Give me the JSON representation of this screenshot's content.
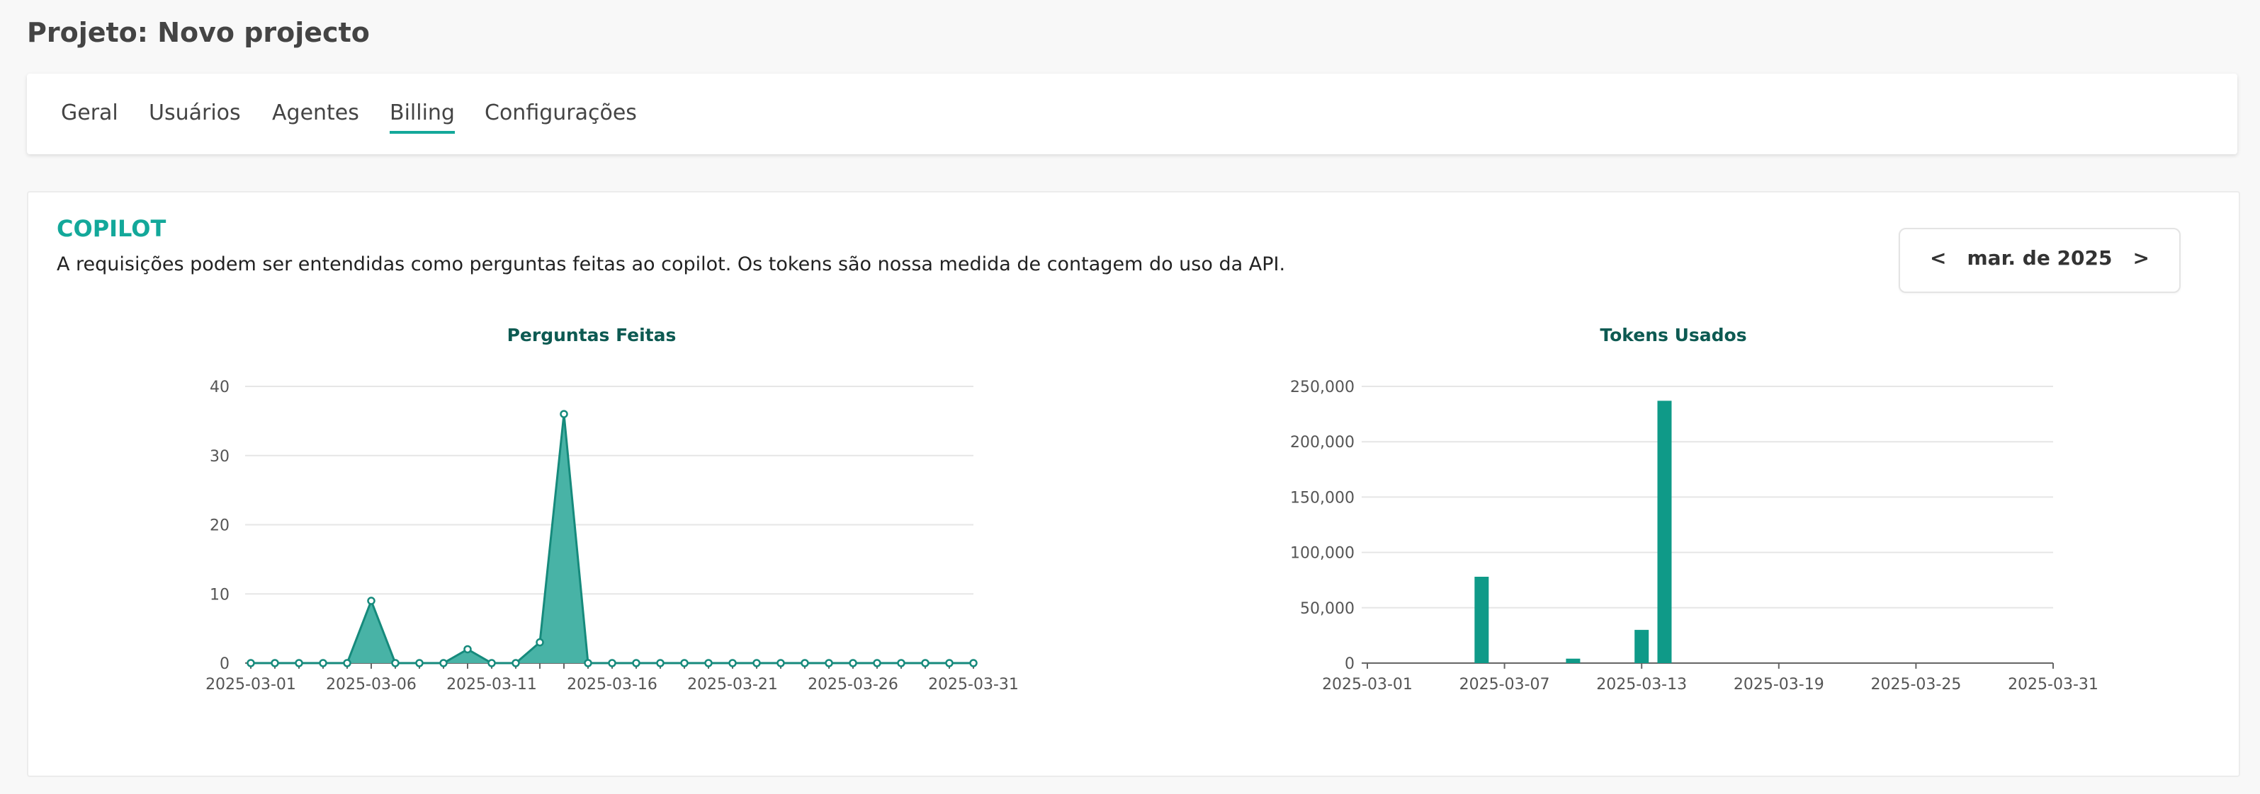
{
  "page": {
    "title": "Projeto: Novo projecto"
  },
  "tabs": [
    {
      "label": "Geral",
      "active": false
    },
    {
      "label": "Usuários",
      "active": false
    },
    {
      "label": "Agentes",
      "active": false
    },
    {
      "label": "Billing",
      "active": true
    },
    {
      "label": "Configurações",
      "active": false
    }
  ],
  "copilot": {
    "title": "COPILOT",
    "description": "A requisições podem ser entendidas como perguntas feitas ao copilot. Os tokens são nossa medida de contagem do uso da API.",
    "month_nav": {
      "prev": "<",
      "label": "mar. de 2025",
      "next": ">"
    }
  },
  "colors": {
    "accent": "#13a89a",
    "chart_fill": "#48b3a6",
    "chart_line": "#168a7c",
    "bar": "#0f9a88",
    "chart_title": "#0d5a52"
  },
  "chart_data": [
    {
      "type": "area",
      "title": "Perguntas Feitas",
      "x": [
        "2025-03-01",
        "2025-03-02",
        "2025-03-03",
        "2025-03-04",
        "2025-03-05",
        "2025-03-06",
        "2025-03-07",
        "2025-03-08",
        "2025-03-09",
        "2025-03-10",
        "2025-03-11",
        "2025-03-12",
        "2025-03-13",
        "2025-03-14",
        "2025-03-15",
        "2025-03-16",
        "2025-03-17",
        "2025-03-18",
        "2025-03-19",
        "2025-03-20",
        "2025-03-21",
        "2025-03-22",
        "2025-03-23",
        "2025-03-24",
        "2025-03-25",
        "2025-03-26",
        "2025-03-27",
        "2025-03-28",
        "2025-03-29",
        "2025-03-30",
        "2025-03-31"
      ],
      "values": [
        0,
        0,
        0,
        0,
        0,
        9,
        0,
        0,
        0,
        2,
        0,
        0,
        3,
        36,
        0,
        0,
        0,
        0,
        0,
        0,
        0,
        0,
        0,
        0,
        0,
        0,
        0,
        0,
        0,
        0,
        0
      ],
      "xticks": [
        "2025-03-01",
        "2025-03-06",
        "2025-03-11",
        "2025-03-16",
        "2025-03-21",
        "2025-03-26",
        "2025-03-31"
      ],
      "yticks": [
        "0",
        "10",
        "20",
        "30",
        "40"
      ],
      "ylim": [
        0,
        40
      ],
      "grid": true
    },
    {
      "type": "bar",
      "title": "Tokens Usados",
      "x": [
        "2025-03-06",
        "2025-03-10",
        "2025-03-13",
        "2025-03-14"
      ],
      "values": [
        78000,
        4000,
        30000,
        237000
      ],
      "xticks": [
        "2025-03-01",
        "2025-03-07",
        "2025-03-13",
        "2025-03-19",
        "2025-03-25",
        "2025-03-31"
      ],
      "yticks": [
        "0",
        "50,000",
        "100,000",
        "150,000",
        "200,000",
        "250,000"
      ],
      "xlim": [
        "2025-03-01",
        "2025-03-31"
      ],
      "ylim": [
        0,
        250000
      ],
      "grid": true
    }
  ]
}
